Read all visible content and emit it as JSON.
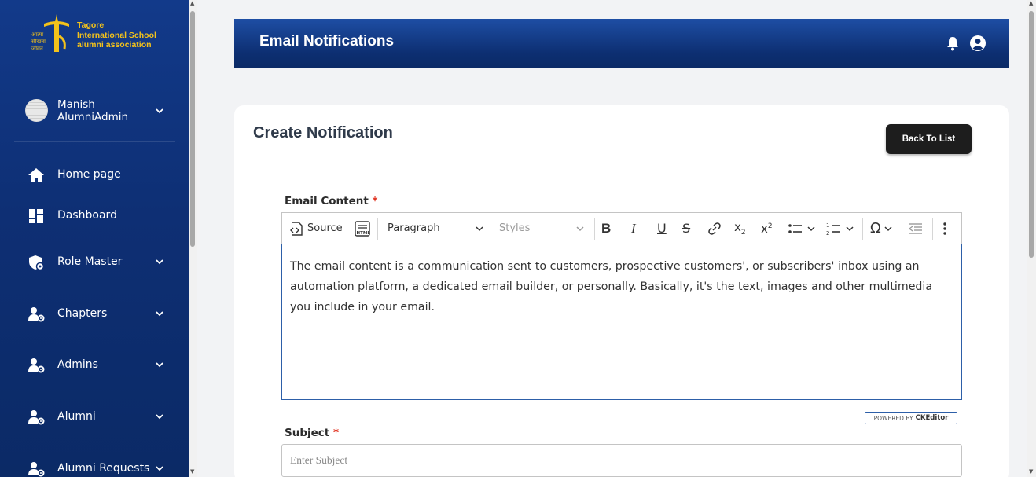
{
  "sidebar": {
    "logo_lines": [
      "Tagore",
      "International School",
      "alumni association"
    ],
    "user": {
      "name": "Manish AlumniAdmin"
    },
    "items": [
      {
        "label": "Home page",
        "icon": "home-icon",
        "has_children": false
      },
      {
        "label": "Dashboard",
        "icon": "dashboard-icon",
        "has_children": false
      },
      {
        "label": "Role Master",
        "icon": "role-shield-icon",
        "has_children": true
      },
      {
        "label": "Chapters",
        "icon": "user-gear-icon",
        "has_children": true
      },
      {
        "label": "Admins",
        "icon": "user-gear-icon",
        "has_children": true
      },
      {
        "label": "Alumni",
        "icon": "user-gear-icon",
        "has_children": true
      },
      {
        "label": "Alumni Requests",
        "icon": "user-gear-icon",
        "has_children": true
      }
    ]
  },
  "header": {
    "title": "Email Notifications"
  },
  "card": {
    "title": "Create Notification",
    "back_button": "Back To List",
    "email_content_label": "Email Content",
    "subject_label": "Subject",
    "required_mark": "*",
    "subject_placeholder": "Enter Subject"
  },
  "toolbar": {
    "source_label": "Source",
    "paragraph_label": "Paragraph",
    "styles_label": "Styles"
  },
  "editor": {
    "content": "The email content is a communication sent to customers, prospective customers', or subscribers' inbox using an automation platform, a dedicated email builder, or personally. Basically, it's the text, images and other multimedia you include in your email."
  },
  "powered_by": {
    "prefix": "POWERED BY",
    "brand": "CKEditor"
  },
  "colors": {
    "sidebar": "#0e2f74",
    "header": "#0d2f72",
    "accent": "#f3c21b",
    "button": "#1d1d1d"
  }
}
